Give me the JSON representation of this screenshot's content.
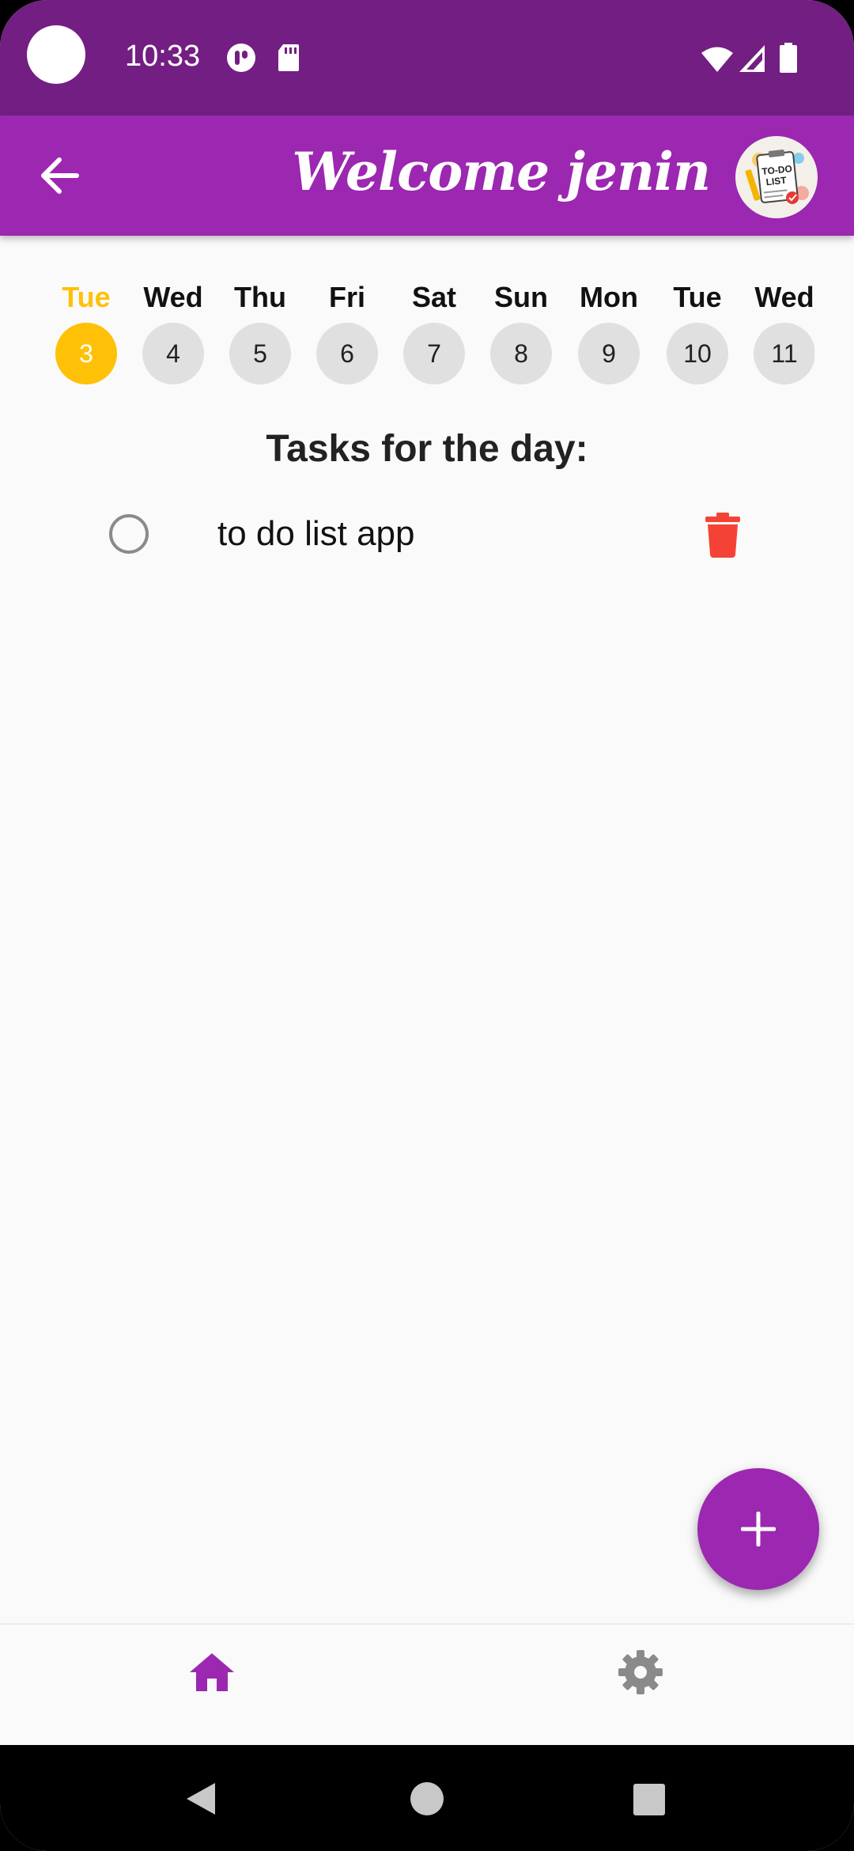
{
  "status_bar": {
    "time": "10:33"
  },
  "app_bar": {
    "title": "Welcome jenin",
    "logo_lines": [
      "TO-DO",
      "LIST"
    ]
  },
  "days": [
    {
      "name": "Tue",
      "num": "3",
      "selected": true
    },
    {
      "name": "Wed",
      "num": "4"
    },
    {
      "name": "Thu",
      "num": "5"
    },
    {
      "name": "Fri",
      "num": "6"
    },
    {
      "name": "Sat",
      "num": "7"
    },
    {
      "name": "Sun",
      "num": "8"
    },
    {
      "name": "Mon",
      "num": "9"
    },
    {
      "name": "Tue",
      "num": "10"
    },
    {
      "name": "Wed",
      "num": "11"
    }
  ],
  "tasks": {
    "title": "Tasks for the day:",
    "items": [
      {
        "text": "to do list app",
        "done": false
      }
    ]
  },
  "colors": {
    "status_bar": "#731e82",
    "primary": "#9c27b0",
    "selected_day": "#ffc107",
    "delete": "#f44336"
  },
  "icons": {
    "back": "arrow-back-icon",
    "add": "plus-icon",
    "home": "home-icon",
    "settings": "gear-icon",
    "delete": "trash-icon"
  }
}
